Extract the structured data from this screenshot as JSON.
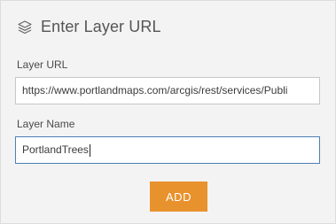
{
  "header": {
    "title": "Enter Layer URL",
    "icon": "layers-icon"
  },
  "form": {
    "url_label": "Layer URL",
    "url_value": "https://www.portlandmaps.com/arcgis/rest/services/Publi",
    "name_label": "Layer Name",
    "name_value": "PortlandTrees"
  },
  "actions": {
    "add_label": "ADD"
  },
  "colors": {
    "panel_bg": "#f3f3f3",
    "accent_button": "#e8922e",
    "focus_border": "#4d7fb3"
  }
}
